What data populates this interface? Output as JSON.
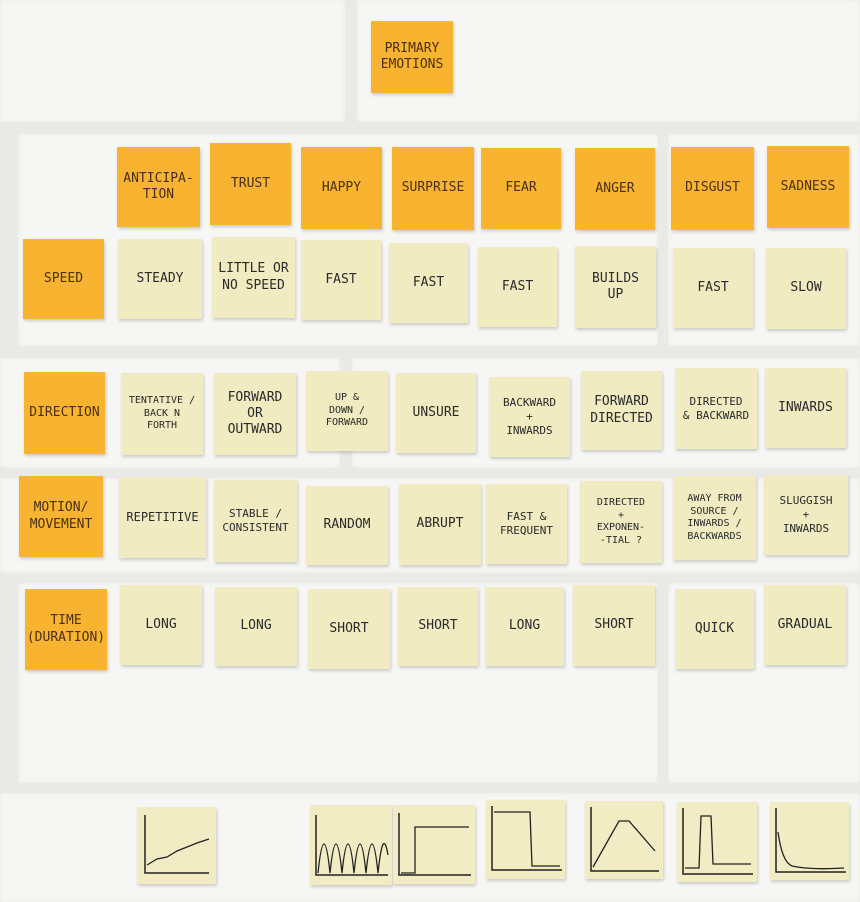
{
  "title": "PRIMARY EMOTIONS",
  "emotions": [
    "ANTICIPA-\nTION",
    "TRUST",
    "HAPPY",
    "SURPRISE",
    "FEAR",
    "ANGER",
    "DISGUST",
    "SADNESS"
  ],
  "rows": [
    {
      "label": "SPEED",
      "values": [
        "STEADY",
        "LITTLE OR\nNO SPEED",
        "FAST",
        "FAST",
        "FAST",
        "BUILDS\nUP",
        "FAST",
        "SLOW"
      ]
    },
    {
      "label": "DIRECTION",
      "values": [
        "TENTATIVE /\nBACK N\nFORTH",
        "FORWARD\nOR\nOUTWARD",
        "UP &\nDOWN /\nFORWARD",
        "UNSURE",
        "BACKWARD\n+\nINWARDS",
        "FORWARD\nDIRECTED",
        "DIRECTED\n& BACKWARD",
        "INWARDS"
      ]
    },
    {
      "label": "MOTION/\nMOVEMENT",
      "values": [
        "REPETITIVE",
        "STABLE /\nCONSISTENT",
        "RANDOM",
        "ABRUPT",
        "FAST &\nFREQUENT",
        "DIRECTED\n+\nEXPONEN-\n-TIAL ?",
        "AWAY FROM\nSOURCE /\nINWARDS /\nBACKWARDS",
        "SLUGGISH\n+\nINWARDS"
      ]
    },
    {
      "label": "TIME\n(DURATION)",
      "values": [
        "LONG",
        "LONG",
        "SHORT",
        "SHORT",
        "LONG",
        "SHORT",
        "QUICK",
        "GRADUAL"
      ]
    }
  ],
  "colors": {
    "orange": "#f8b331",
    "pale": "#f0ebc0",
    "wall": "#f6f6f4"
  }
}
